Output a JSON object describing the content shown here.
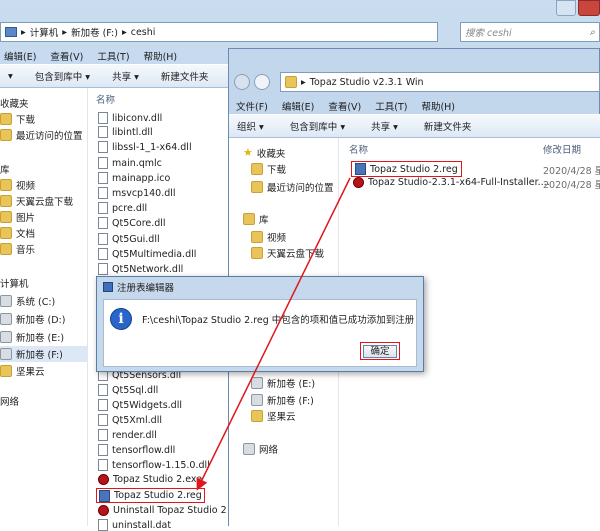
{
  "back_window": {
    "address": [
      "计算机",
      "新加卷 (F:)",
      "ceshi"
    ],
    "search_placeholder": "搜索 ceshi",
    "menu": [
      "编辑(E)",
      "查看(V)",
      "工具(T)",
      "帮助(H)"
    ],
    "toolbar": [
      "包含到库中 ▾",
      "共享 ▾",
      "新建文件夹"
    ],
    "column_name": "名称",
    "nav": [
      "收藏夹",
      "下载",
      "最近访问的位置",
      "库",
      "视频",
      "天翼云盘下载",
      "图片",
      "文档",
      "音乐",
      "计算机",
      "系统 (C:)",
      "新加卷 (D:)",
      "新加卷 (E:)",
      "新加卷 (F:)",
      "坚果云",
      "网络"
    ],
    "files": [
      "libiconv.dll",
      "libintl.dll",
      "libssl-1_1-x64.dll",
      "main.qmlc",
      "mainapp.ico",
      "msvcp140.dll",
      "pcre.dll",
      "Qt5Core.dll",
      "Qt5Gui.dll",
      "Qt5Multimedia.dll",
      "Qt5Network.dll",
      "Qt5Sensors.dll",
      "Qt5Sql.dll",
      "Qt5Widgets.dll",
      "Qt5Xml.dll",
      "render.dll",
      "tensorflow.dll",
      "tensorflow-1.15.0.dll",
      "Topaz Studio 2.exe",
      "Topaz Studio 2.reg",
      "Uninstall Topaz Studio 2",
      "uninstall.dat"
    ]
  },
  "front_window": {
    "address": [
      "Topaz Studio v2.3.1 Win"
    ],
    "menu": [
      "文件(F)",
      "编辑(E)",
      "查看(V)",
      "工具(T)",
      "帮助(H)"
    ],
    "toolbar": [
      "组织 ▾",
      "包含到库中 ▾",
      "共享 ▾",
      "新建文件夹"
    ],
    "column_name": "名称",
    "column_date": "修改日期",
    "nav": [
      "收藏夹",
      "下载",
      "最近访问的位置",
      "库",
      "视频",
      "天翼云盘下载",
      "新加卷 (E:)",
      "新加卷 (F:)",
      "坚果云",
      "网络"
    ],
    "files": [
      {
        "name": "Topaz Studio 2.reg",
        "date": "2020/4/28 星期"
      },
      {
        "name": "Topaz Studio-2.3.1-x64-Full-Installer....",
        "date": "2020/4/28 星期"
      }
    ]
  },
  "dialog": {
    "title": "注册表编辑器",
    "message": "F:\\ceshi\\Topaz Studio 2.reg 中包含的项和值已成功添加到注册表中。",
    "ok_label": "确定"
  },
  "colors": {
    "highlight": "#e0161b",
    "window_frame": "#b9d1ea"
  }
}
